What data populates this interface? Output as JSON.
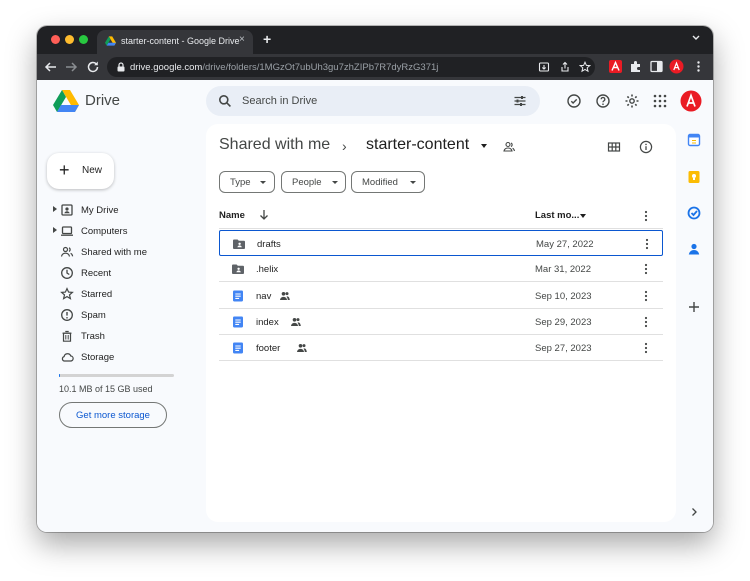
{
  "browser": {
    "tab_title": "starter-content - Google Drive",
    "tab_close": "×",
    "new_tab": "+",
    "url_host": "drive.google.com",
    "url_path": "/drive/folders/1MGzOt7ubUh3gu7zhZIPb7R7dyRzG371j"
  },
  "header": {
    "brand": "Drive",
    "search_placeholder": "Search in Drive"
  },
  "sidebar": {
    "new_label": "New",
    "items": [
      {
        "label": "My Drive",
        "icon": "my-drive-icon",
        "expandable": true
      },
      {
        "label": "Computers",
        "icon": "computer-icon",
        "expandable": true
      },
      {
        "label": "Shared with me",
        "icon": "people-icon",
        "expandable": false
      },
      {
        "label": "Recent",
        "icon": "clock-icon",
        "expandable": false
      },
      {
        "label": "Starred",
        "icon": "star-icon",
        "expandable": false
      },
      {
        "label": "Spam",
        "icon": "spam-icon",
        "expandable": false
      },
      {
        "label": "Trash",
        "icon": "trash-icon",
        "expandable": false
      },
      {
        "label": "Storage",
        "icon": "cloud-icon",
        "expandable": false
      }
    ],
    "storage_text": "10.1 MB of 15 GB used",
    "storage_used_fraction": 0.01,
    "get_storage_label": "Get more storage"
  },
  "main": {
    "breadcrumb_parent": "Shared with me",
    "breadcrumb_sep": "›",
    "breadcrumb_current": "starter-content",
    "filters": [
      "Type",
      "People",
      "Modified"
    ],
    "columns": {
      "name": "Name",
      "modified": "Last mo..."
    },
    "files": [
      {
        "name": "drafts",
        "type": "shared-folder",
        "shared": false,
        "date": "May 27, 2022",
        "selected": true
      },
      {
        "name": ".helix",
        "type": "shared-folder",
        "shared": false,
        "date": "Mar 31, 2022",
        "selected": false
      },
      {
        "name": "nav",
        "type": "doc",
        "shared": true,
        "date": "Sep 10, 2023",
        "selected": false
      },
      {
        "name": "index",
        "type": "doc",
        "shared": true,
        "date": "Sep 29, 2023",
        "selected": false
      },
      {
        "name": "footer",
        "type": "doc",
        "shared": true,
        "date": "Sep 27, 2023",
        "selected": false
      }
    ]
  },
  "colors": {
    "accent": "#0b57d0",
    "doc_blue": "#4285f4",
    "avatar_red": "#ea1b24"
  }
}
